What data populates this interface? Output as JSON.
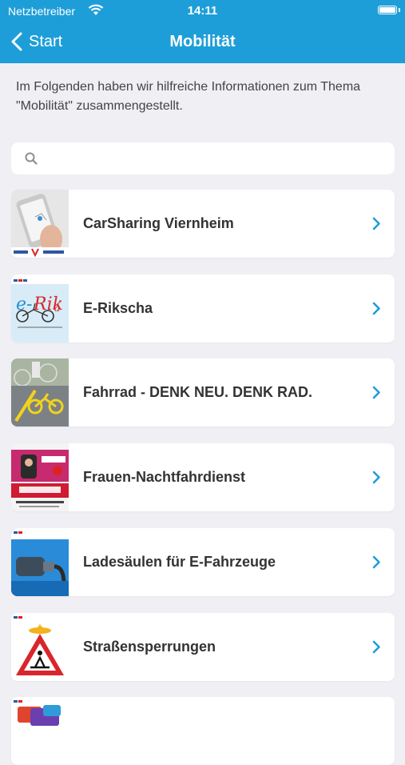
{
  "status_bar": {
    "carrier": "Netzbetreiber",
    "time": "14:11"
  },
  "nav": {
    "back_label": "Start",
    "title": "Mobilität"
  },
  "intro": "Im Folgenden haben wir hilfreiche Informationen zum Thema \"Mobilität\" zusammengestellt.",
  "search": {
    "placeholder": ""
  },
  "colors": {
    "accent": "#1e9ed8",
    "background": "#efeff4",
    "text": "#333333"
  },
  "items": [
    {
      "label": "CarSharing Viernheim"
    },
    {
      "label": "E-Rikscha"
    },
    {
      "label": "Fahrrad - DENK NEU. DENK RAD."
    },
    {
      "label": "Frauen-Nachtfahrdienst"
    },
    {
      "label": "Ladesäulen für E-Fahrzeuge"
    },
    {
      "label": "Straßensperrungen"
    },
    {
      "label": ""
    }
  ]
}
